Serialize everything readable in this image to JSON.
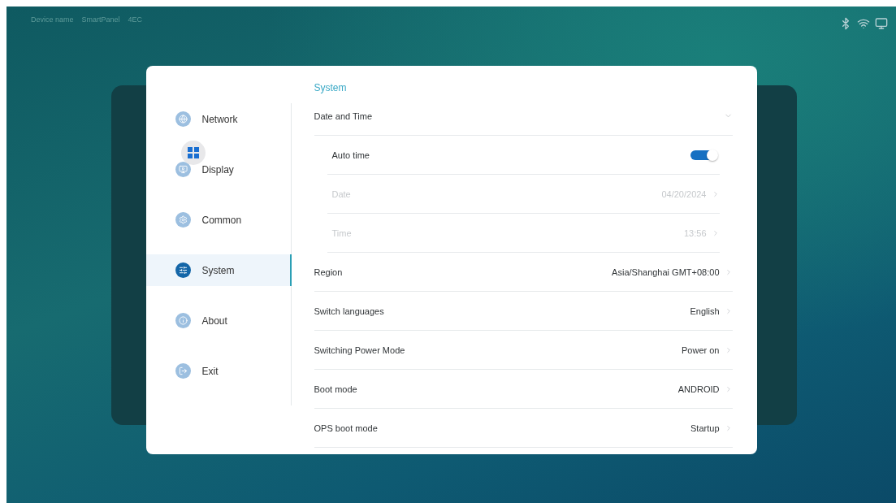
{
  "status_bar": {
    "texts": [
      "Device name",
      "SmartPanel",
      "4EC"
    ]
  },
  "sidebar": {
    "items": [
      {
        "label": "Network",
        "selected": false
      },
      {
        "label": "Display",
        "selected": false
      },
      {
        "label": "Common",
        "selected": false
      },
      {
        "label": "System",
        "selected": true
      },
      {
        "label": "About",
        "selected": false
      },
      {
        "label": "Exit",
        "selected": false
      }
    ]
  },
  "panel": {
    "title": "System",
    "rows": [
      {
        "kind": "group",
        "label": "Date and Time",
        "expanded": true,
        "children": [
          {
            "kind": "toggle",
            "label": "Auto time",
            "on": true
          },
          {
            "kind": "value",
            "label": "Date",
            "value": "04/20/2024",
            "disabled": true
          },
          {
            "kind": "value",
            "label": "Time",
            "value": "13:56",
            "disabled": true
          }
        ]
      },
      {
        "kind": "value",
        "label": "Region",
        "value": "Asia/Shanghai GMT+08:00",
        "disabled": false
      },
      {
        "kind": "value",
        "label": "Switch languages",
        "value": "English",
        "disabled": false
      },
      {
        "kind": "value",
        "label": "Switching Power Mode",
        "value": "Power on",
        "disabled": false
      },
      {
        "kind": "value",
        "label": "Boot mode",
        "value": "ANDROID",
        "disabled": false
      },
      {
        "kind": "value",
        "label": "OPS boot mode",
        "value": "Startup",
        "disabled": false
      }
    ]
  }
}
